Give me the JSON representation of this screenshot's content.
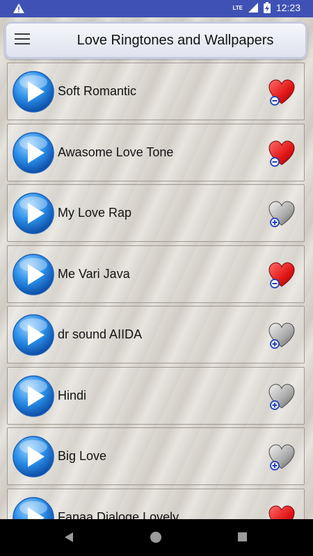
{
  "status_bar": {
    "time": "12:23",
    "network": "LTE"
  },
  "header": {
    "title": "Love Ringtones and Wallpapers"
  },
  "ringtones": [
    {
      "title": "Soft Romantic",
      "favorite": true
    },
    {
      "title": "Awasome Love Tone",
      "favorite": true
    },
    {
      "title": "My Love Rap",
      "favorite": false
    },
    {
      "title": "Me Vari Java",
      "favorite": true
    },
    {
      "title": "dr sound AIIDA",
      "favorite": false
    },
    {
      "title": "Hindi",
      "favorite": false
    },
    {
      "title": "Big Love",
      "favorite": false
    },
    {
      "title": "Fanaa Dialoge Lovely",
      "favorite": true
    }
  ],
  "icons": {
    "play": "play-circle-icon",
    "favorite_on": "heart-remove-icon",
    "favorite_off": "heart-add-icon"
  },
  "colors": {
    "status_bar": "#3f51b5",
    "heart_on": "#e01515",
    "heart_off": "#9a9a9a",
    "play_blue": "#2a8ee8"
  }
}
